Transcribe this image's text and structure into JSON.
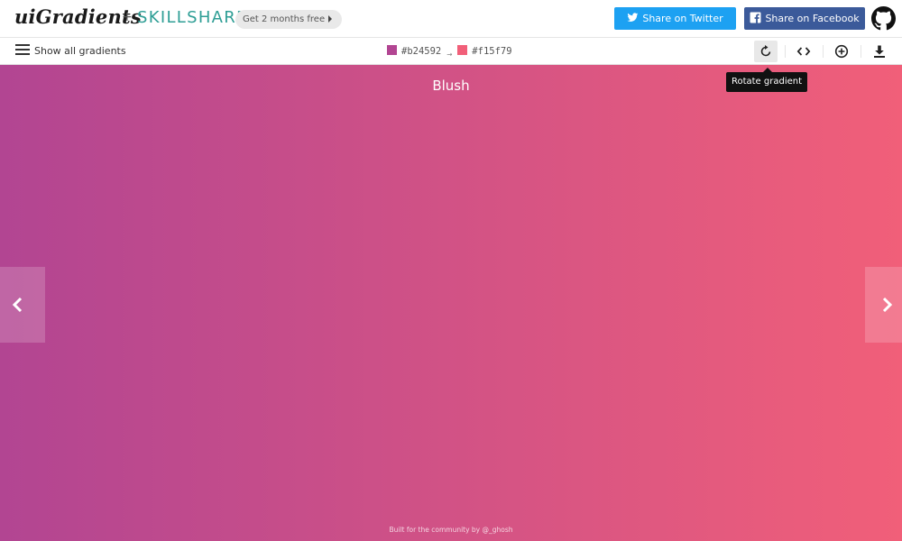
{
  "header": {
    "logo_text": "uiGradients",
    "plus": "+",
    "partner": "SKILLSHARE",
    "promo_label": "Get 2 months free",
    "twitter_label": "Share on Twitter",
    "facebook_label": "Share on Facebook"
  },
  "toolbar": {
    "show_all_label": "Show all gradients",
    "color_from": "#b24592",
    "arrow": "→",
    "color_to": "#f15f79"
  },
  "tooltip": {
    "text": "Rotate gradient"
  },
  "gradient": {
    "name": "Blush",
    "start_color": "#b24592",
    "end_color": "#f15f79",
    "direction": "to right"
  },
  "footer": {
    "text": "Built for the community by @_ghosh"
  },
  "icons": {
    "twitter": "twitter-bird-icon",
    "facebook": "facebook-f-icon",
    "github": "github-octocat-icon",
    "menu": "hamburger-menu-icon",
    "rotate": "rotate-icon",
    "code": "code-brackets-icon",
    "add": "plus-circle-icon",
    "download": "download-icon",
    "prev": "chevron-left-icon",
    "next": "chevron-right-icon"
  },
  "colors": {
    "twitter_brand": "#1da1f2",
    "facebook_brand": "#3b5a9a",
    "skillshare_brand": "#2e9e95"
  }
}
